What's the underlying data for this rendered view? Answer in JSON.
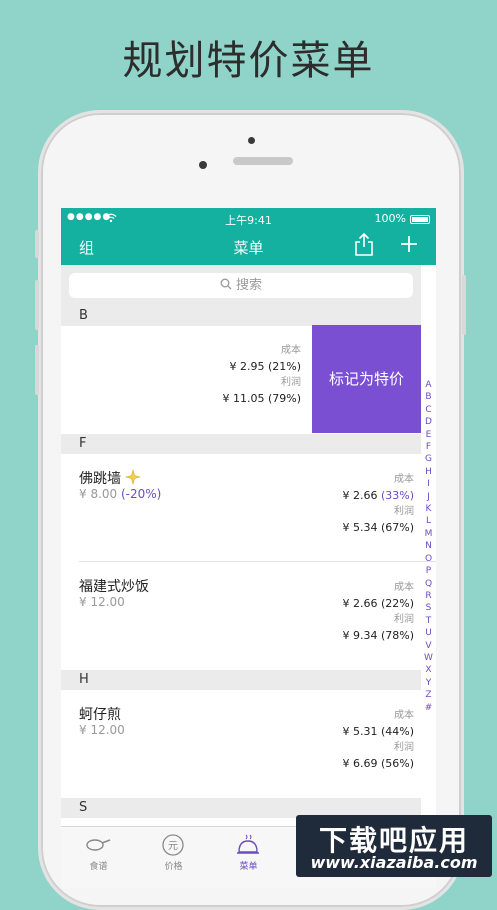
{
  "headline": "规划特价菜单",
  "status": {
    "signal": "●●●●●",
    "time": "上午9:41",
    "battery": "100%"
  },
  "nav": {
    "left": "组",
    "title": "菜单"
  },
  "search": {
    "placeholder": "搜索",
    "icon": "search-icon"
  },
  "sections": {
    "b": "B",
    "f": "F",
    "h": "H",
    "s": "S"
  },
  "items": [
    {
      "name": "",
      "price": "",
      "cost_label": "成本",
      "cost": "¥ 2.95 (21%)",
      "profit_label": "利润",
      "profit": "¥ 11.05 (79%)"
    },
    {
      "name": "佛跳墙",
      "price_base": "¥ 8.00",
      "price_diff": "(-20%)",
      "cost_label": "成本",
      "cost_base": "¥ 2.66",
      "cost_pct": "(33%)",
      "profit_label": "利润",
      "profit": "¥ 5.34 (67%)",
      "special_icon": "sparkle-icon"
    },
    {
      "name": "福建式炒饭",
      "price": "¥ 12.00",
      "cost_label": "成本",
      "cost": "¥ 2.66 (22%)",
      "profit_label": "利润",
      "profit": "¥ 9.34 (78%)"
    },
    {
      "name": "蚵仔煎",
      "price": "¥ 12.00",
      "cost_label": "成本",
      "cost": "¥ 5.31 (44%)",
      "profit_label": "利润",
      "profit": "¥ 6.69 (56%)"
    }
  ],
  "swipe_action": "标记为特价",
  "index": [
    "A",
    "B",
    "C",
    "D",
    "E",
    "F",
    "G",
    "H",
    "I",
    "J",
    "K",
    "L",
    "M",
    "N",
    "O",
    "P",
    "Q",
    "R",
    "S",
    "T",
    "U",
    "V",
    "W",
    "X",
    "Y",
    "Z",
    "#"
  ],
  "tabs": [
    {
      "label": "食谱",
      "icon": "pan-icon"
    },
    {
      "label": "价格",
      "icon": "yuan-coin-icon",
      "glyph": "元"
    },
    {
      "label": "菜单",
      "icon": "cloche-icon",
      "active": true
    }
  ],
  "watermark": {
    "line1": "下载吧应用",
    "line2": "www.xiazaiba.com"
  },
  "colors": {
    "accent": "#14b0a0",
    "purple": "#7a4fd2",
    "background": "#8fd3c9"
  }
}
